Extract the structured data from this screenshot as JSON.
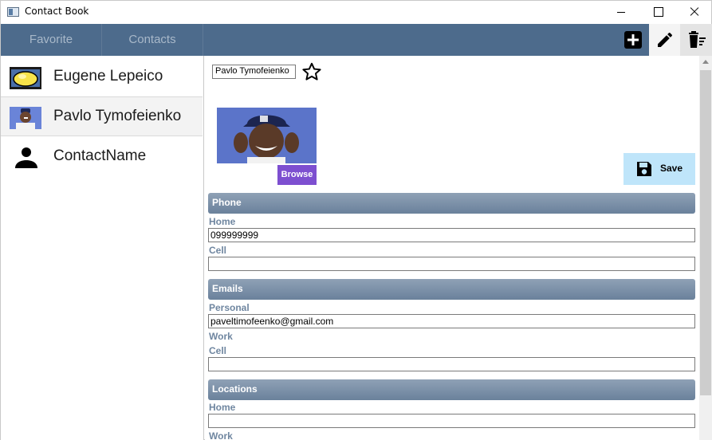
{
  "window": {
    "title": "Contact Book"
  },
  "nav": {
    "tabs": [
      {
        "label": "Favorite"
      },
      {
        "label": "Contacts"
      }
    ],
    "tools": [
      "add-icon",
      "edit-icon",
      "delete-icon"
    ]
  },
  "contacts": [
    {
      "name": "Eugene Lepeico"
    },
    {
      "name": "Pavlo Tymofeienko"
    },
    {
      "name": "ContactName"
    }
  ],
  "detail": {
    "name": "Pavlo Tymofeienko",
    "browse_label": "Browse",
    "save_label": "Save",
    "sections": {
      "phone": {
        "title": "Phone",
        "home_label": "Home",
        "home_value": "099999999",
        "cell_label": "Cell",
        "cell_value": ""
      },
      "emails": {
        "title": "Emails",
        "personal_label": "Personal",
        "personal_value": "paveltimofeenko@gmail.com",
        "work_label": "Work",
        "cell_label": "Cell",
        "cell_value": ""
      },
      "locations": {
        "title": "Locations",
        "home_label": "Home",
        "home_value": "",
        "work_label": "Work"
      }
    }
  },
  "colors": {
    "nav_bg": "#4d6b8c",
    "section_header": "#7b90a8",
    "label_text": "#6f86a0",
    "browse_button": "#7d4fd0",
    "save_button": "#bfe5fa"
  }
}
